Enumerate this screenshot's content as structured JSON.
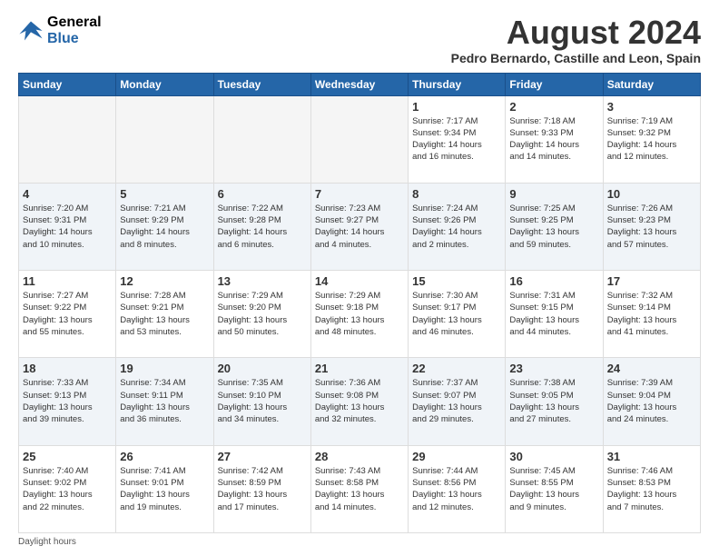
{
  "logo": {
    "line1": "General",
    "line2": "Blue"
  },
  "title": "August 2024",
  "subtitle": "Pedro Bernardo, Castille and Leon, Spain",
  "days_of_week": [
    "Sunday",
    "Monday",
    "Tuesday",
    "Wednesday",
    "Thursday",
    "Friday",
    "Saturday"
  ],
  "weeks": [
    [
      {
        "day": "",
        "info": ""
      },
      {
        "day": "",
        "info": ""
      },
      {
        "day": "",
        "info": ""
      },
      {
        "day": "",
        "info": ""
      },
      {
        "day": "1",
        "info": "Sunrise: 7:17 AM\nSunset: 9:34 PM\nDaylight: 14 hours\nand 16 minutes."
      },
      {
        "day": "2",
        "info": "Sunrise: 7:18 AM\nSunset: 9:33 PM\nDaylight: 14 hours\nand 14 minutes."
      },
      {
        "day": "3",
        "info": "Sunrise: 7:19 AM\nSunset: 9:32 PM\nDaylight: 14 hours\nand 12 minutes."
      }
    ],
    [
      {
        "day": "4",
        "info": "Sunrise: 7:20 AM\nSunset: 9:31 PM\nDaylight: 14 hours\nand 10 minutes."
      },
      {
        "day": "5",
        "info": "Sunrise: 7:21 AM\nSunset: 9:29 PM\nDaylight: 14 hours\nand 8 minutes."
      },
      {
        "day": "6",
        "info": "Sunrise: 7:22 AM\nSunset: 9:28 PM\nDaylight: 14 hours\nand 6 minutes."
      },
      {
        "day": "7",
        "info": "Sunrise: 7:23 AM\nSunset: 9:27 PM\nDaylight: 14 hours\nand 4 minutes."
      },
      {
        "day": "8",
        "info": "Sunrise: 7:24 AM\nSunset: 9:26 PM\nDaylight: 14 hours\nand 2 minutes."
      },
      {
        "day": "9",
        "info": "Sunrise: 7:25 AM\nSunset: 9:25 PM\nDaylight: 13 hours\nand 59 minutes."
      },
      {
        "day": "10",
        "info": "Sunrise: 7:26 AM\nSunset: 9:23 PM\nDaylight: 13 hours\nand 57 minutes."
      }
    ],
    [
      {
        "day": "11",
        "info": "Sunrise: 7:27 AM\nSunset: 9:22 PM\nDaylight: 13 hours\nand 55 minutes."
      },
      {
        "day": "12",
        "info": "Sunrise: 7:28 AM\nSunset: 9:21 PM\nDaylight: 13 hours\nand 53 minutes."
      },
      {
        "day": "13",
        "info": "Sunrise: 7:29 AM\nSunset: 9:20 PM\nDaylight: 13 hours\nand 50 minutes."
      },
      {
        "day": "14",
        "info": "Sunrise: 7:29 AM\nSunset: 9:18 PM\nDaylight: 13 hours\nand 48 minutes."
      },
      {
        "day": "15",
        "info": "Sunrise: 7:30 AM\nSunset: 9:17 PM\nDaylight: 13 hours\nand 46 minutes."
      },
      {
        "day": "16",
        "info": "Sunrise: 7:31 AM\nSunset: 9:15 PM\nDaylight: 13 hours\nand 44 minutes."
      },
      {
        "day": "17",
        "info": "Sunrise: 7:32 AM\nSunset: 9:14 PM\nDaylight: 13 hours\nand 41 minutes."
      }
    ],
    [
      {
        "day": "18",
        "info": "Sunrise: 7:33 AM\nSunset: 9:13 PM\nDaylight: 13 hours\nand 39 minutes."
      },
      {
        "day": "19",
        "info": "Sunrise: 7:34 AM\nSunset: 9:11 PM\nDaylight: 13 hours\nand 36 minutes."
      },
      {
        "day": "20",
        "info": "Sunrise: 7:35 AM\nSunset: 9:10 PM\nDaylight: 13 hours\nand 34 minutes."
      },
      {
        "day": "21",
        "info": "Sunrise: 7:36 AM\nSunset: 9:08 PM\nDaylight: 13 hours\nand 32 minutes."
      },
      {
        "day": "22",
        "info": "Sunrise: 7:37 AM\nSunset: 9:07 PM\nDaylight: 13 hours\nand 29 minutes."
      },
      {
        "day": "23",
        "info": "Sunrise: 7:38 AM\nSunset: 9:05 PM\nDaylight: 13 hours\nand 27 minutes."
      },
      {
        "day": "24",
        "info": "Sunrise: 7:39 AM\nSunset: 9:04 PM\nDaylight: 13 hours\nand 24 minutes."
      }
    ],
    [
      {
        "day": "25",
        "info": "Sunrise: 7:40 AM\nSunset: 9:02 PM\nDaylight: 13 hours\nand 22 minutes."
      },
      {
        "day": "26",
        "info": "Sunrise: 7:41 AM\nSunset: 9:01 PM\nDaylight: 13 hours\nand 19 minutes."
      },
      {
        "day": "27",
        "info": "Sunrise: 7:42 AM\nSunset: 8:59 PM\nDaylight: 13 hours\nand 17 minutes."
      },
      {
        "day": "28",
        "info": "Sunrise: 7:43 AM\nSunset: 8:58 PM\nDaylight: 13 hours\nand 14 minutes."
      },
      {
        "day": "29",
        "info": "Sunrise: 7:44 AM\nSunset: 8:56 PM\nDaylight: 13 hours\nand 12 minutes."
      },
      {
        "day": "30",
        "info": "Sunrise: 7:45 AM\nSunset: 8:55 PM\nDaylight: 13 hours\nand 9 minutes."
      },
      {
        "day": "31",
        "info": "Sunrise: 7:46 AM\nSunset: 8:53 PM\nDaylight: 13 hours\nand 7 minutes."
      }
    ]
  ],
  "footer": "Daylight hours"
}
